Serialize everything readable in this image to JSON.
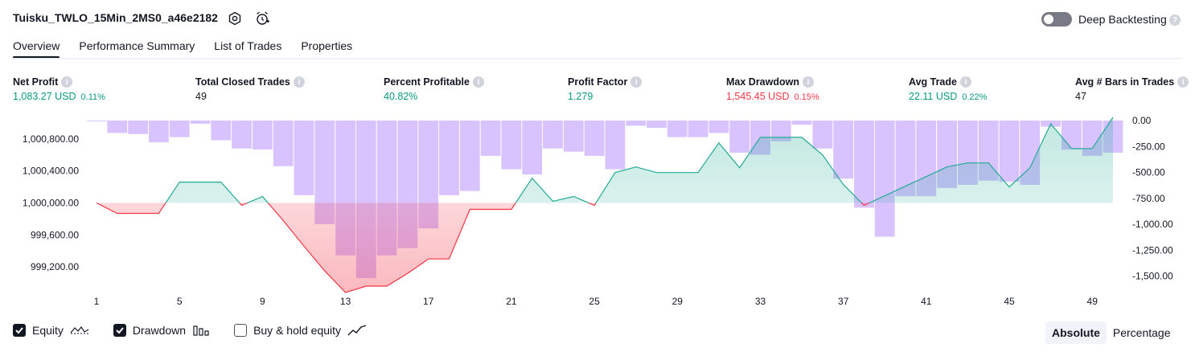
{
  "header": {
    "title": "Tuisku_TWLO_15Min_2MS0_a46e2182",
    "deep_backtesting_label": "Deep Backtesting",
    "deep_backtesting_enabled": false
  },
  "tabs": [
    {
      "label": "Overview",
      "active": true
    },
    {
      "label": "Performance Summary",
      "active": false
    },
    {
      "label": "List of Trades",
      "active": false
    },
    {
      "label": "Properties",
      "active": false
    }
  ],
  "metrics": {
    "net_profit": {
      "label": "Net Profit",
      "value": "1,083.27 USD",
      "pct": "0.11%"
    },
    "total_closed_trades": {
      "label": "Total Closed Trades",
      "value": "49"
    },
    "percent_profitable": {
      "label": "Percent Profitable",
      "value": "40.82%"
    },
    "profit_factor": {
      "label": "Profit Factor",
      "value": "1.279"
    },
    "max_drawdown": {
      "label": "Max Drawdown",
      "value": "1,545.45 USD",
      "pct": "0.15%"
    },
    "avg_trade": {
      "label": "Avg Trade",
      "value": "22.11 USD",
      "pct": "0.22%"
    },
    "avg_bars": {
      "label": "Avg # Bars in Trades",
      "value": "47"
    }
  },
  "colors": {
    "positive": "#089981",
    "negative": "#f23645",
    "drawdown_bar": "#b388ff",
    "equity_line_up": "#22ab94",
    "equity_line_down": "#f23645"
  },
  "legend": {
    "equity": {
      "label": "Equity",
      "checked": true
    },
    "drawdown": {
      "label": "Drawdown",
      "checked": true
    },
    "buy_hold": {
      "label": "Buy & hold equity",
      "checked": false
    }
  },
  "view_toggle": {
    "absolute": "Absolute",
    "percentage": "Percentage",
    "selected": "Absolute"
  },
  "chart_data": {
    "type": "line+bar",
    "x_ticks": [
      "1",
      "5",
      "9",
      "13",
      "17",
      "21",
      "25",
      "29",
      "33",
      "37",
      "41",
      "45",
      "49"
    ],
    "left_axis": {
      "ticks": [
        "1,000,800.00",
        "1,000,400.00",
        "1,000,000.00",
        "999,600.00",
        "999,200.00"
      ],
      "range": [
        998900,
        1001050
      ]
    },
    "right_axis": {
      "ticks": [
        "0.00",
        "-250.00",
        "-500.00",
        "-750.00",
        "-1,000.00",
        "-1,250.00",
        "-1,500.00"
      ],
      "range": [
        -1550,
        0
      ]
    },
    "baseline": 1000000,
    "series": [
      {
        "name": "Equity",
        "x": [
          1,
          2,
          3,
          4,
          5,
          6,
          7,
          8,
          9,
          10,
          11,
          12,
          13,
          14,
          15,
          16,
          17,
          18,
          19,
          20,
          21,
          22,
          23,
          24,
          25,
          26,
          27,
          28,
          29,
          30,
          31,
          32,
          33,
          34,
          35,
          36,
          37,
          38,
          39,
          40,
          41,
          42,
          43,
          44,
          45,
          46,
          47,
          48,
          49,
          50
        ],
        "values": [
          1000000,
          999870,
          999870,
          999870,
          1000260,
          1000260,
          1000260,
          999970,
          1000080,
          999780,
          999460,
          999150,
          998880,
          998960,
          998960,
          999120,
          999300,
          999300,
          999920,
          999920,
          999920,
          1000310,
          1000020,
          1000080,
          999970,
          1000380,
          1000450,
          1000380,
          1000380,
          1000380,
          1000750,
          1000440,
          1000820,
          1000820,
          1000820,
          1000600,
          1000230,
          999970,
          1000090,
          1000210,
          1000330,
          1000450,
          1000500,
          1000500,
          1000200,
          1000440,
          1000990,
          1000680,
          1000680,
          1001070
        ]
      },
      {
        "name": "Drawdown",
        "x": [
          1,
          2,
          3,
          4,
          5,
          6,
          7,
          8,
          9,
          10,
          11,
          12,
          13,
          14,
          15,
          16,
          17,
          18,
          19,
          20,
          21,
          22,
          23,
          24,
          25,
          26,
          27,
          28,
          29,
          30,
          31,
          32,
          33,
          34,
          35,
          36,
          37,
          38,
          39,
          40,
          41,
          42,
          43,
          44,
          45,
          46,
          47,
          48,
          49,
          50
        ],
        "values": [
          -5,
          -120,
          -130,
          -210,
          -160,
          -30,
          -190,
          -270,
          -280,
          -440,
          -720,
          -1000,
          -1300,
          -1520,
          -1300,
          -1230,
          -1040,
          -720,
          -680,
          -340,
          -470,
          -520,
          -270,
          -300,
          -340,
          -470,
          -50,
          -70,
          -160,
          -160,
          -120,
          -310,
          -330,
          -200,
          -40,
          -270,
          -560,
          -840,
          -1120,
          -730,
          -730,
          -650,
          -620,
          -580,
          -590,
          -620,
          -60,
          -280,
          -340,
          -310
        ]
      }
    ]
  }
}
